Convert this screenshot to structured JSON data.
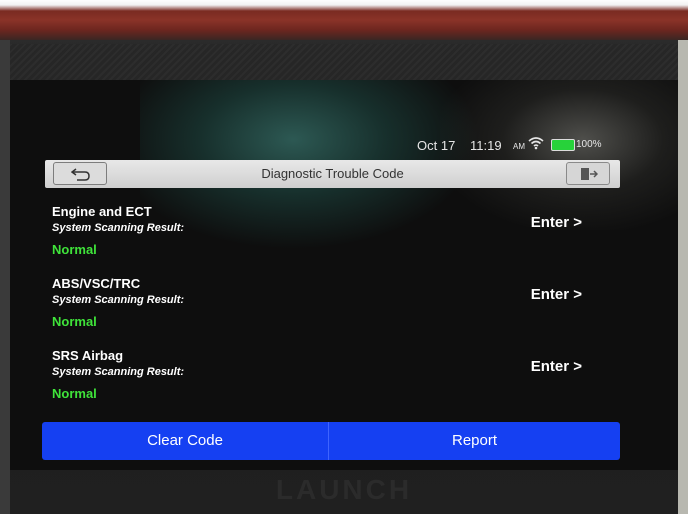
{
  "status_bar": {
    "date": "Oct 17",
    "time": "11:19",
    "ampm": "AM",
    "wifi_icon": "wifi-icon",
    "battery_icon": "battery-icon",
    "battery_label": "100%"
  },
  "title_bar": {
    "title": "Diagnostic Trouble Code",
    "back_icon": "back-arrow-icon",
    "exit_icon": "exit-icon"
  },
  "systems": [
    {
      "name": "Engine and ECT",
      "subtitle": "System Scanning Result:",
      "result": "Normal",
      "action": "Enter >"
    },
    {
      "name": "ABS/VSC/TRC",
      "subtitle": "System Scanning Result:",
      "result": "Normal",
      "action": "Enter >"
    },
    {
      "name": "SRS Airbag",
      "subtitle": "System Scanning Result:",
      "result": "Normal",
      "action": "Enter >"
    }
  ],
  "buttons": {
    "clear": "Clear Code",
    "report": "Report"
  },
  "brand": "LAUNCH",
  "colors": {
    "normal_status": "#3fe33a",
    "button_bar": "#1540f2",
    "title_bar": "#d9d9d9"
  }
}
